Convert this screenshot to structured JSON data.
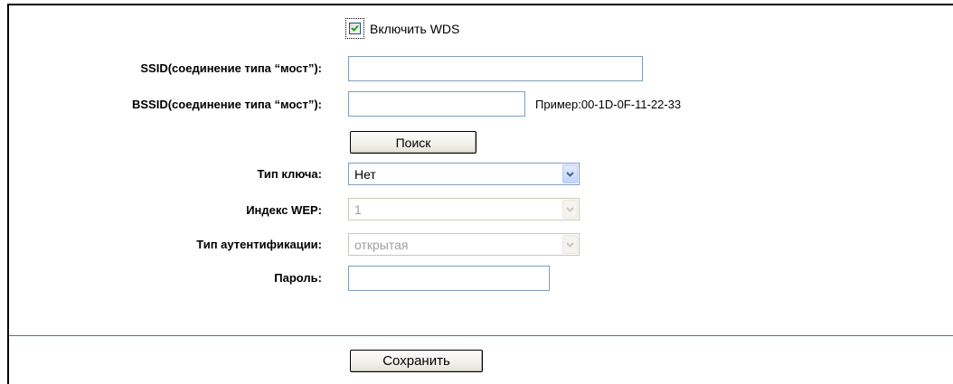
{
  "wds": {
    "enable_label": "Включить WDS",
    "checked": true
  },
  "form": {
    "ssid": {
      "label": "SSID(соединение типа “мост”):",
      "value": ""
    },
    "bssid": {
      "label": "BSSID(соединение типа “мост”):",
      "value": "",
      "hint": "Пример:00-1D-0F-11-22-33"
    },
    "search_button": "Поиск",
    "key_type": {
      "label": "Тип ключа:",
      "value": "Нет"
    },
    "wep_index": {
      "label": "Индекс WEP:",
      "value": "1"
    },
    "auth_type": {
      "label": "Тип аутентификации:",
      "value": "открытая"
    },
    "password": {
      "label": "Пароль:",
      "value": ""
    }
  },
  "footer": {
    "save_button": "Сохранить"
  },
  "colors": {
    "divider": "#3f8a3f",
    "input_border": "#7f9db9",
    "disabled_text": "#a0a0a0"
  },
  "icons": {
    "checkbox": "checkmark-icon",
    "dropdown": "chevron-down-icon"
  }
}
